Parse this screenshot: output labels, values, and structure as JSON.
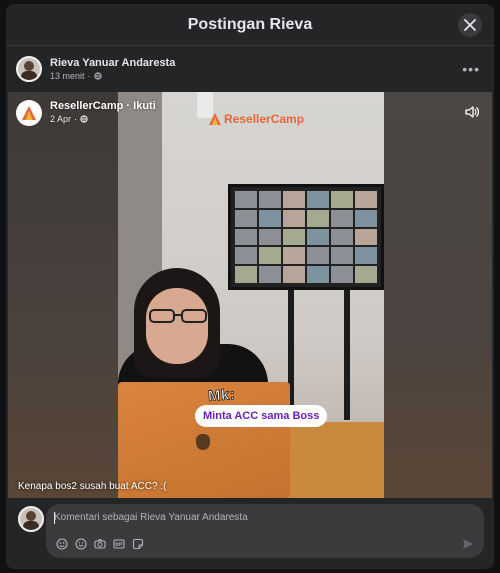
{
  "modal": {
    "title": "Postingan Rieva",
    "close_icon": "close-icon"
  },
  "post": {
    "author_name": "Rieva Yanuar Andaresta",
    "time": "13 menit",
    "separator": "·",
    "privacy_icon": "globe-icon",
    "more_label": "•••"
  },
  "shared": {
    "page_name": "ResellerCamp · Ikuti",
    "date": "2 Apr",
    "separator": "·",
    "privacy_icon": "globe-icon"
  },
  "video": {
    "brand_text": "ResellerCamp",
    "overlay_label": "Mk:",
    "overlay_pill": "Minta ACC sama Boss",
    "caption": "Kenapa bos2 susah buat ACC? :(",
    "volume_icon": "volume-icon"
  },
  "comment": {
    "placeholder": "Komentari sebagai Rieva Yanuar Andaresta",
    "tools": [
      "avatar-sticker-icon",
      "emoji-icon",
      "camera-icon",
      "gif-icon",
      "sticker-icon"
    ],
    "send_icon": "send-icon"
  },
  "colors": {
    "modal_bg": "#242526",
    "input_bg": "#3a3b3c",
    "accent_purple": "#6a1fbf",
    "brand_orange": "#e8673a"
  }
}
